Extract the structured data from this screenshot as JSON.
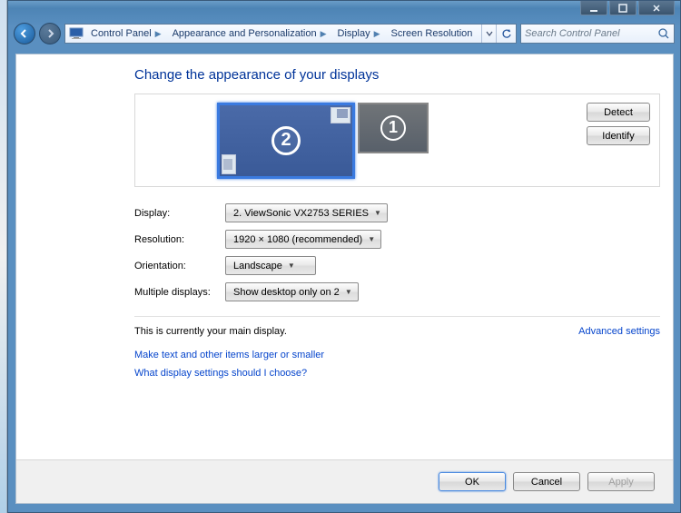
{
  "breadcrumbs": [
    "Control Panel",
    "Appearance and Personalization",
    "Display",
    "Screen Resolution"
  ],
  "search": {
    "placeholder": "Search Control Panel"
  },
  "page_title": "Change the appearance of your displays",
  "monitor_buttons": {
    "detect": "Detect",
    "identify": "Identify"
  },
  "monitors": {
    "primary": "2",
    "secondary": "1"
  },
  "form": {
    "display_label": "Display:",
    "display_value": "2. ViewSonic VX2753 SERIES",
    "resolution_label": "Resolution:",
    "resolution_value": "1920 × 1080 (recommended)",
    "orientation_label": "Orientation:",
    "orientation_value": "Landscape",
    "multiple_label": "Multiple displays:",
    "multiple_value": "Show desktop only on 2"
  },
  "status": {
    "main_display": "This is currently your main display.",
    "advanced": "Advanced settings"
  },
  "links": {
    "text_size": "Make text and other items larger or smaller",
    "help": "What display settings should I choose?"
  },
  "footer": {
    "ok": "OK",
    "cancel": "Cancel",
    "apply": "Apply"
  }
}
